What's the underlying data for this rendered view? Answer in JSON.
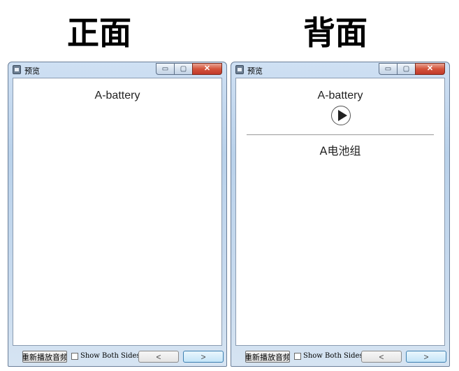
{
  "headings": {
    "front": "正面",
    "back": "背面"
  },
  "window": {
    "title": "预览",
    "minimize_glyph": "▭",
    "maximize_glyph": "▢",
    "close_glyph": "✕"
  },
  "front_card": {
    "question": "A-battery"
  },
  "back_card": {
    "question": "A-battery",
    "answer": "A电池组"
  },
  "bottom_bar": {
    "replay_label": "重新播放音频",
    "show_both_sides_label": "Show Both Sides",
    "show_both_sides_checked": false,
    "prev_glyph": "<",
    "next_glyph": ">"
  },
  "icons": {
    "app": "preview-app-icon",
    "play": "play-icon",
    "minimize": "minimize-icon",
    "maximize": "maximize-icon",
    "close": "close-icon"
  },
  "colors": {
    "close_button": "#c0392b",
    "frame": "#b9d1ea",
    "next_button_border": "#3c7fb1"
  }
}
